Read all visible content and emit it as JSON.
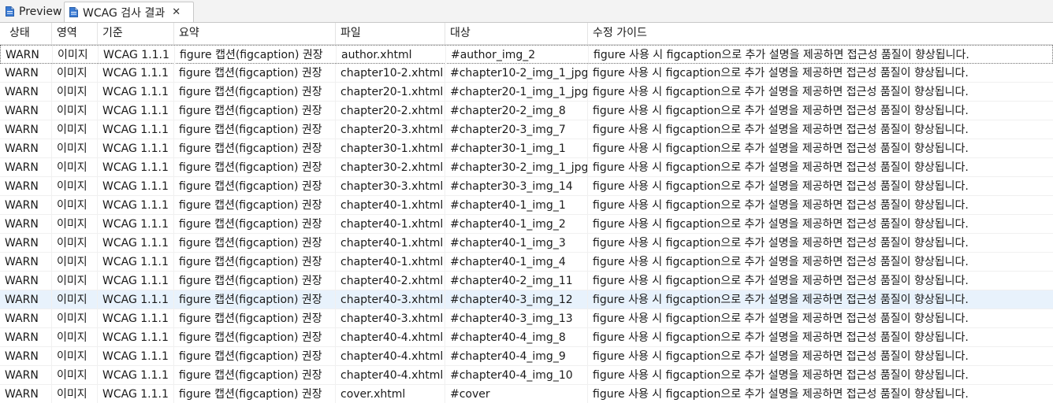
{
  "tabs": [
    {
      "label": "Preview",
      "icon": "document-icon",
      "active": false
    },
    {
      "label": "WCAG 검사 결과",
      "icon": "document-icon",
      "active": true
    }
  ],
  "close_glyph": "✕",
  "accent_color": "#3a7bd5",
  "highlight_color": "#e8f2fc",
  "table": {
    "columns": [
      "상태",
      "영역",
      "기준",
      "요약",
      "파일",
      "대상",
      "수정 가이드"
    ],
    "rows": [
      [
        "WARN",
        "이미지",
        "WCAG 1.1.1",
        "figure 캡션(figcaption) 권장",
        "author.xhtml",
        "#author_img_2",
        "figure 사용 시 figcaption으로 추가 설명을 제공하면 접근성 품질이 향상됩니다."
      ],
      [
        "WARN",
        "이미지",
        "WCAG 1.1.1",
        "figure 캡션(figcaption) 권장",
        "chapter10-2.xhtml",
        "#chapter10-2_img_1_jpg",
        "figure 사용 시 figcaption으로 추가 설명을 제공하면 접근성 품질이 향상됩니다."
      ],
      [
        "WARN",
        "이미지",
        "WCAG 1.1.1",
        "figure 캡션(figcaption) 권장",
        "chapter20-1.xhtml",
        "#chapter20-1_img_1_jpg",
        "figure 사용 시 figcaption으로 추가 설명을 제공하면 접근성 품질이 향상됩니다."
      ],
      [
        "WARN",
        "이미지",
        "WCAG 1.1.1",
        "figure 캡션(figcaption) 권장",
        "chapter20-2.xhtml",
        "#chapter20-2_img_8",
        "figure 사용 시 figcaption으로 추가 설명을 제공하면 접근성 품질이 향상됩니다."
      ],
      [
        "WARN",
        "이미지",
        "WCAG 1.1.1",
        "figure 캡션(figcaption) 권장",
        "chapter20-3.xhtml",
        "#chapter20-3_img_7",
        "figure 사용 시 figcaption으로 추가 설명을 제공하면 접근성 품질이 향상됩니다."
      ],
      [
        "WARN",
        "이미지",
        "WCAG 1.1.1",
        "figure 캡션(figcaption) 권장",
        "chapter30-1.xhtml",
        "#chapter30-1_img_1",
        "figure 사용 시 figcaption으로 추가 설명을 제공하면 접근성 품질이 향상됩니다."
      ],
      [
        "WARN",
        "이미지",
        "WCAG 1.1.1",
        "figure 캡션(figcaption) 권장",
        "chapter30-2.xhtml",
        "#chapter30-2_img_1_jpg",
        "figure 사용 시 figcaption으로 추가 설명을 제공하면 접근성 품질이 향상됩니다."
      ],
      [
        "WARN",
        "이미지",
        "WCAG 1.1.1",
        "figure 캡션(figcaption) 권장",
        "chapter30-3.xhtml",
        "#chapter30-3_img_14",
        "figure 사용 시 figcaption으로 추가 설명을 제공하면 접근성 품질이 향상됩니다."
      ],
      [
        "WARN",
        "이미지",
        "WCAG 1.1.1",
        "figure 캡션(figcaption) 권장",
        "chapter40-1.xhtml",
        "#chapter40-1_img_1",
        "figure 사용 시 figcaption으로 추가 설명을 제공하면 접근성 품질이 향상됩니다."
      ],
      [
        "WARN",
        "이미지",
        "WCAG 1.1.1",
        "figure 캡션(figcaption) 권장",
        "chapter40-1.xhtml",
        "#chapter40-1_img_2",
        "figure 사용 시 figcaption으로 추가 설명을 제공하면 접근성 품질이 향상됩니다."
      ],
      [
        "WARN",
        "이미지",
        "WCAG 1.1.1",
        "figure 캡션(figcaption) 권장",
        "chapter40-1.xhtml",
        "#chapter40-1_img_3",
        "figure 사용 시 figcaption으로 추가 설명을 제공하면 접근성 품질이 향상됩니다."
      ],
      [
        "WARN",
        "이미지",
        "WCAG 1.1.1",
        "figure 캡션(figcaption) 권장",
        "chapter40-1.xhtml",
        "#chapter40-1_img_4",
        "figure 사용 시 figcaption으로 추가 설명을 제공하면 접근성 품질이 향상됩니다."
      ],
      [
        "WARN",
        "이미지",
        "WCAG 1.1.1",
        "figure 캡션(figcaption) 권장",
        "chapter40-2.xhtml",
        "#chapter40-2_img_11",
        "figure 사용 시 figcaption으로 추가 설명을 제공하면 접근성 품질이 향상됩니다."
      ],
      [
        "WARN",
        "이미지",
        "WCAG 1.1.1",
        "figure 캡션(figcaption) 권장",
        "chapter40-3.xhtml",
        "#chapter40-3_img_12",
        "figure 사용 시 figcaption으로 추가 설명을 제공하면 접근성 품질이 향상됩니다."
      ],
      [
        "WARN",
        "이미지",
        "WCAG 1.1.1",
        "figure 캡션(figcaption) 권장",
        "chapter40-3.xhtml",
        "#chapter40-3_img_13",
        "figure 사용 시 figcaption으로 추가 설명을 제공하면 접근성 품질이 향상됩니다."
      ],
      [
        "WARN",
        "이미지",
        "WCAG 1.1.1",
        "figure 캡션(figcaption) 권장",
        "chapter40-4.xhtml",
        "#chapter40-4_img_8",
        "figure 사용 시 figcaption으로 추가 설명을 제공하면 접근성 품질이 향상됩니다."
      ],
      [
        "WARN",
        "이미지",
        "WCAG 1.1.1",
        "figure 캡션(figcaption) 권장",
        "chapter40-4.xhtml",
        "#chapter40-4_img_9",
        "figure 사용 시 figcaption으로 추가 설명을 제공하면 접근성 품질이 향상됩니다."
      ],
      [
        "WARN",
        "이미지",
        "WCAG 1.1.1",
        "figure 캡션(figcaption) 권장",
        "chapter40-4.xhtml",
        "#chapter40-4_img_10",
        "figure 사용 시 figcaption으로 추가 설명을 제공하면 접근성 품질이 향상됩니다."
      ],
      [
        "WARN",
        "이미지",
        "WCAG 1.1.1",
        "figure 캡션(figcaption) 권장",
        "cover.xhtml",
        "#cover",
        "figure 사용 시 figcaption으로 추가 설명을 제공하면 접근성 품질이 향상됩니다."
      ]
    ],
    "focused_row_index": 0,
    "highlighted_row_index": 13
  }
}
